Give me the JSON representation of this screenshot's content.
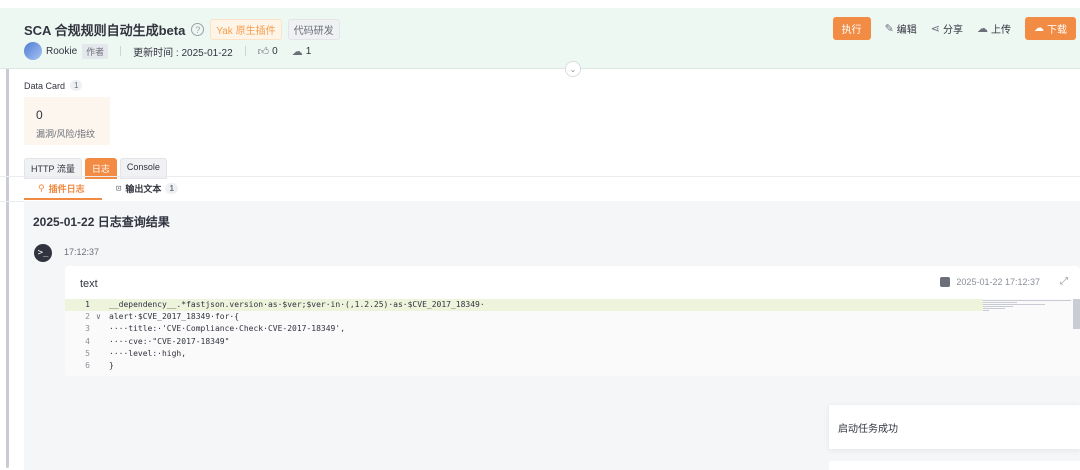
{
  "header": {
    "title": "SCA 合规规则自动生成beta",
    "tags": [
      "Yak 原生插件",
      "代码研发"
    ],
    "author": "Rookie",
    "author_role": "作者",
    "updated": "更新时间 : 2025-01-22",
    "likes": "0",
    "downloads": "1",
    "actions": {
      "run": "执行",
      "edit": "编辑",
      "share": "分享",
      "upload": "上传",
      "download": "下载"
    }
  },
  "data_card": {
    "title": "Data Card",
    "count": "1",
    "value": "0",
    "label": "漏洞/风险/指纹"
  },
  "tabs": [
    "HTTP 流量",
    "日志",
    "Console"
  ],
  "subtabs": {
    "plugin_log": "插件日志",
    "output_text": "输出文本",
    "output_count": "1"
  },
  "log": {
    "title": "2025-01-22 日志查询结果",
    "time": "17:12:37",
    "card_title": "text",
    "card_date": "2025-01-22 17:12:37",
    "code_lines": [
      {
        "num": "1",
        "text": "__dependency__.*fastjson.version·as·$ver;$ver·in·(,1.2.25)·as·$CVE_2017_18349·"
      },
      {
        "num": "2",
        "text": "alert·$CVE_2017_18349·for·{"
      },
      {
        "num": "3",
        "text": "····title:·'CVE·Compliance·Check·CVE-2017-18349',"
      },
      {
        "num": "4",
        "text": "····cve:·\"CVE-2017-18349\""
      },
      {
        "num": "5",
        "text": "····level:·high,"
      },
      {
        "num": "6",
        "text": "}"
      }
    ]
  },
  "toast": {
    "message": "启动任务成功"
  },
  "colors": {
    "accent": "#f28b44",
    "header_bg": "#eef8f2",
    "highlight": "#eef3dc"
  }
}
